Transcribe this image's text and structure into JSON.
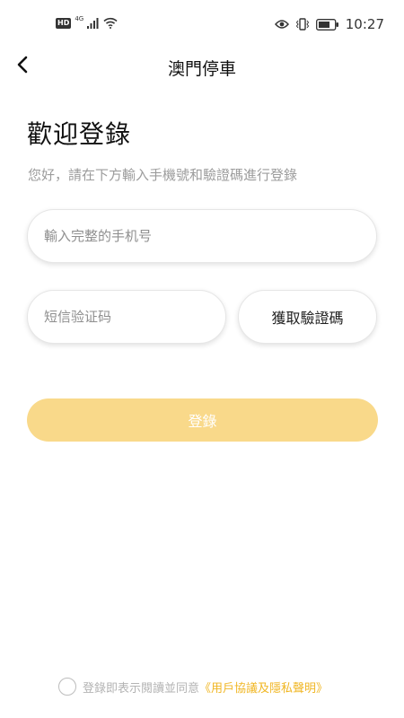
{
  "status_bar": {
    "hd_badge": "HD",
    "network": "4G",
    "time": "10:27"
  },
  "header": {
    "title": "澳門停車"
  },
  "welcome": {
    "title": "歡迎登錄",
    "subtitle": "您好，請在下方輸入手機號和驗證碼進行登錄"
  },
  "form": {
    "phone_placeholder": "輸入完整的手机号",
    "code_placeholder": "短信验证码",
    "get_code_label": "獲取驗證碼",
    "login_label": "登錄"
  },
  "agreement": {
    "text": "登錄即表示閱讀並同意",
    "link": "《用戶協議及隱私聲明》"
  },
  "colors": {
    "accent": "#f0b623",
    "login_button": "#f9d98a"
  },
  "icons": {
    "back": "chevron-left-icon",
    "wifi": "wifi-icon",
    "signal": "signal-icon",
    "eye": "eye-icon",
    "vibrate": "vibrate-icon",
    "battery": "battery-icon"
  }
}
